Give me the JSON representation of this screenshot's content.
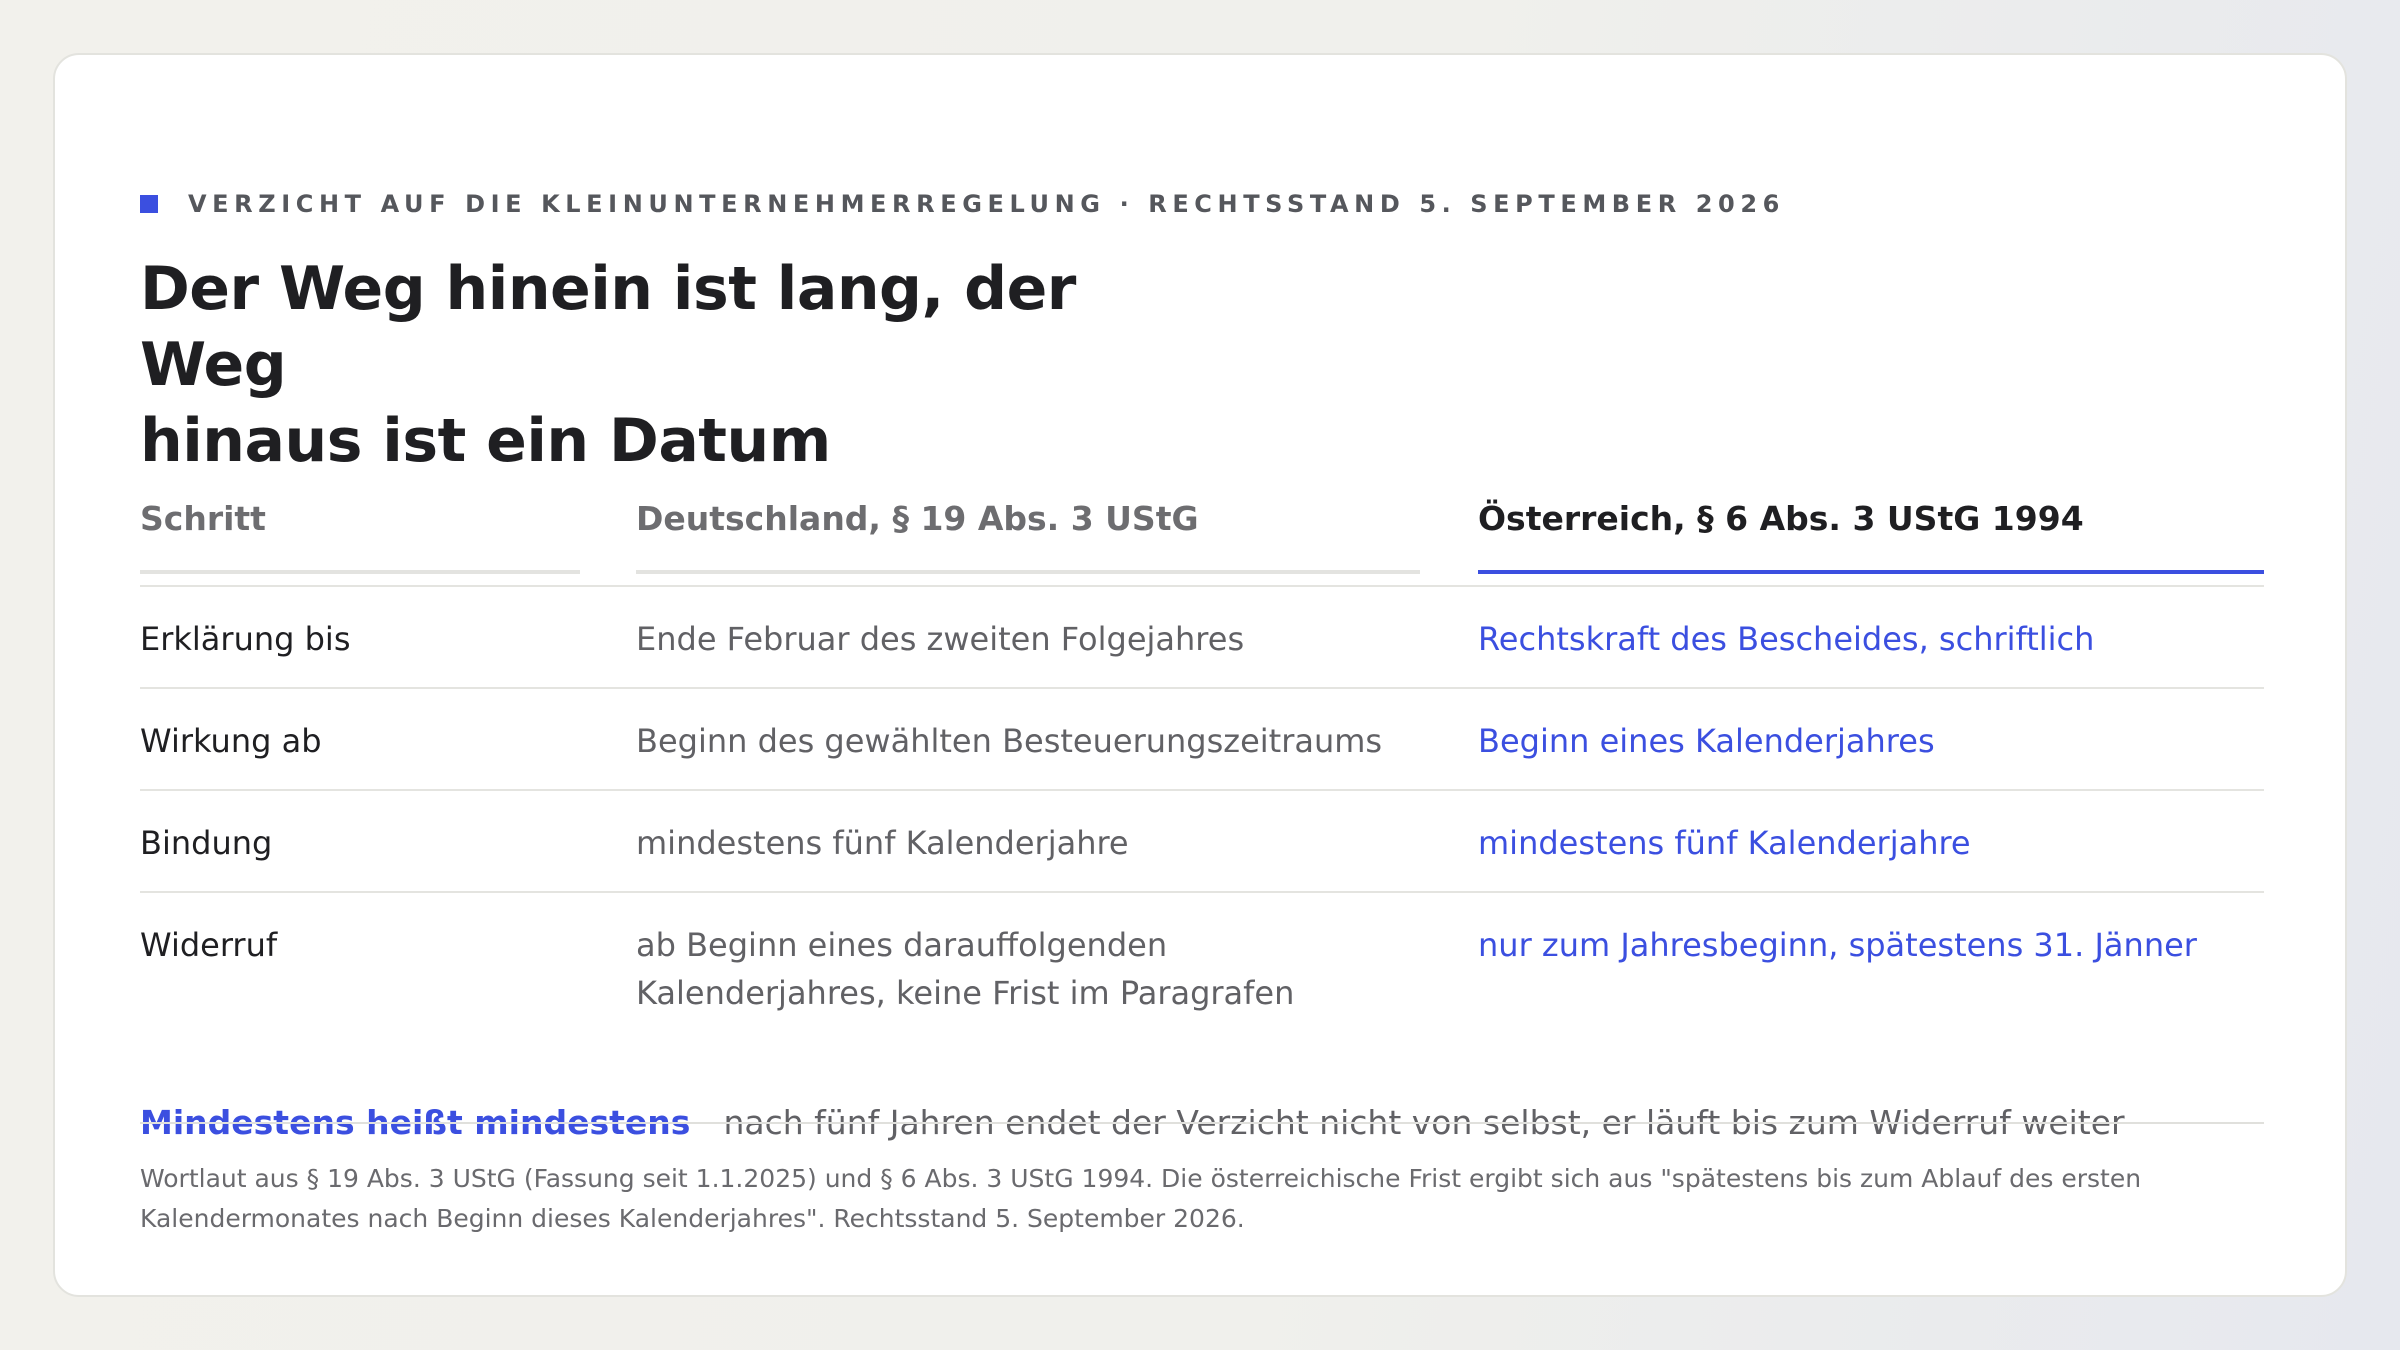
{
  "eyebrow": "VERZICHT AUF DIE KLEINUNTERNEHMERREGELUNG · RECHTSSTAND 5. SEPTEMBER 2026",
  "headline": {
    "line1": "Der Weg hinein ist lang, der Weg",
    "line2": "hinaus ist ein Datum"
  },
  "table": {
    "headers": [
      "Schritt",
      "Deutschland, § 19 Abs. 3 UStG",
      "Österreich, § 6 Abs. 3 UStG 1994"
    ],
    "rows": [
      {
        "step": "Erklärung bis",
        "de": "Ende Februar des zweiten Folgejahres",
        "at": "Rechtskraft des Bescheides, schriftlich"
      },
      {
        "step": "Wirkung ab",
        "de": "Beginn des gewählten Besteuerungszeitraums",
        "at": "Beginn eines Kalenderjahres"
      },
      {
        "step": "Bindung",
        "de": "mindestens fünf Kalenderjahre",
        "at": "mindestens fünf Kalenderjahre"
      },
      {
        "step": "Widerruf",
        "de": "ab Beginn eines darauffolgenden Kalenderjahres, keine Frist im Paragrafen",
        "at": "nur zum Jahresbeginn, spätestens 31. Jänner"
      }
    ]
  },
  "callout": {
    "lead": "Mindestens heißt mindestens",
    "text": "nach fünf Jahren endet der Verzicht nicht von selbst, er läuft bis zum Widerruf weiter"
  },
  "footnote": "Wortlaut aus § 19 Abs. 3 UStG (Fassung seit 1.1.2025) und § 6 Abs. 3 UStG 1994. Die österreichische Frist ergibt sich aus \"spätestens bis zum Ablauf des ersten Kalendermonates nach Beginn dieses Kalenderjahres\". Rechtsstand 5. September 2026.",
  "colors": {
    "accent": "#3b4fe0",
    "text": "#1f1f22",
    "muted": "#616165",
    "rule": "#e4e4e0"
  }
}
